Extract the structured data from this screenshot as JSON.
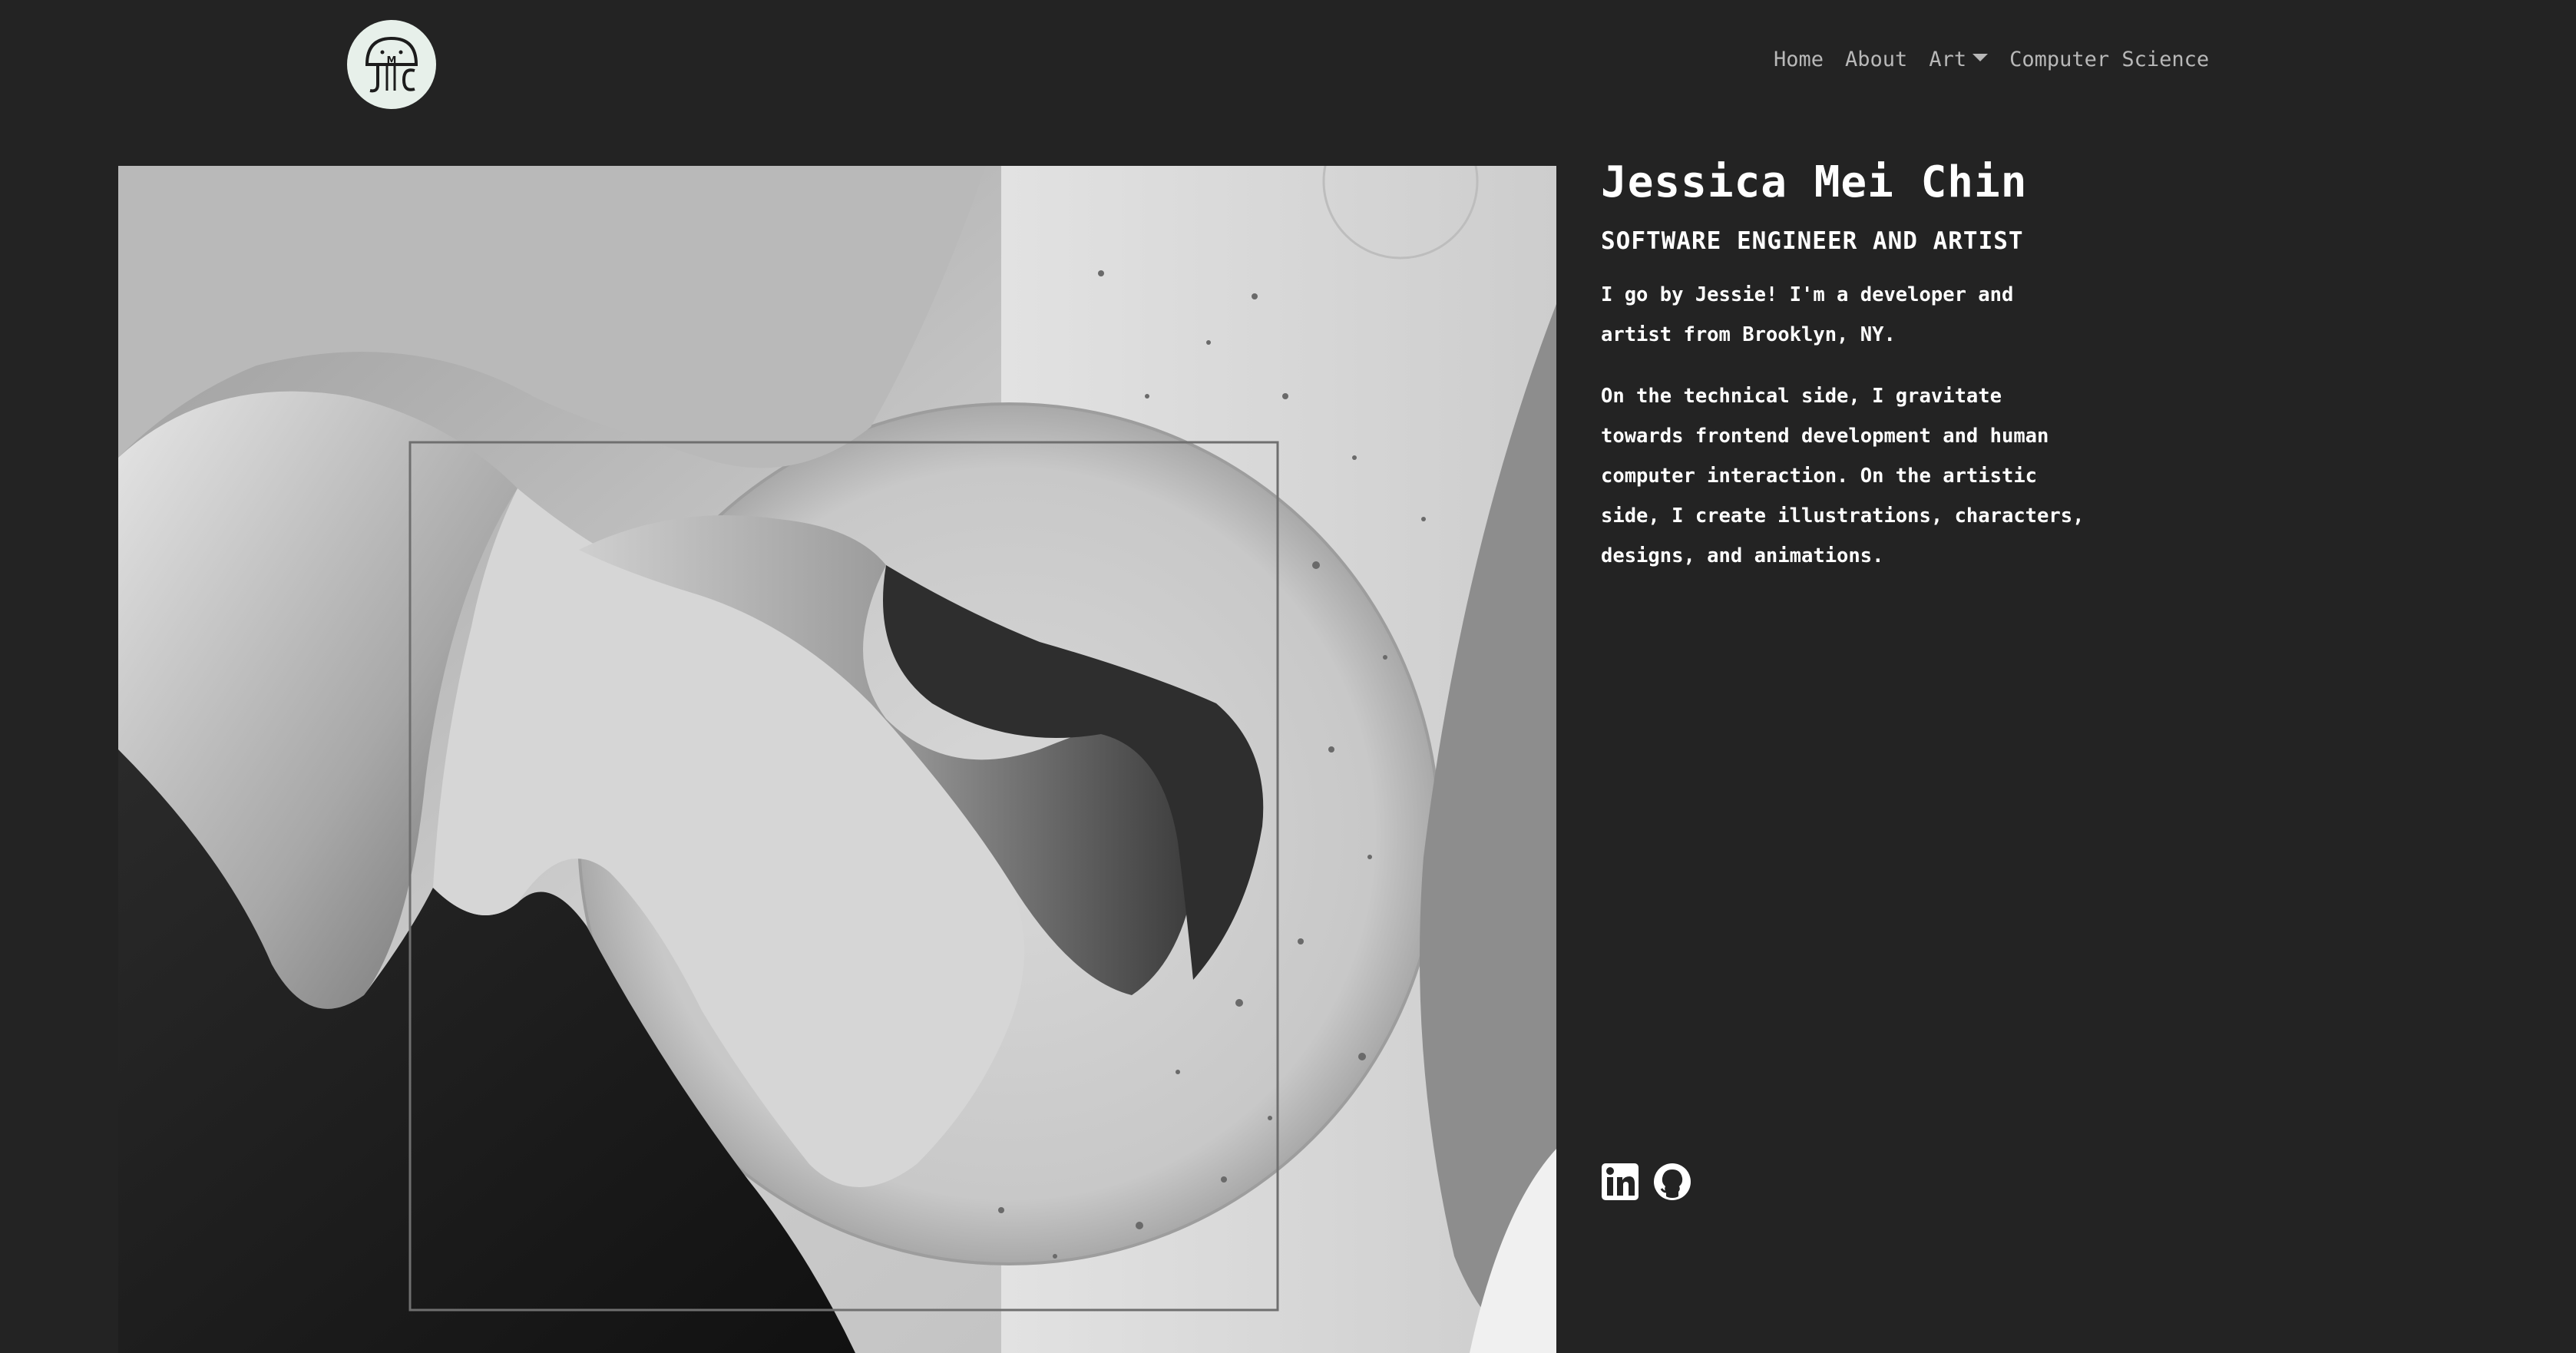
{
  "nav": {
    "logo_alt": "JMC",
    "links": [
      {
        "label": "Home"
      },
      {
        "label": "About"
      },
      {
        "label": "Art"
      },
      {
        "label": "Computer Science"
      }
    ]
  },
  "hero": {
    "name": "Jessica Mei Chin",
    "subtitle": "SOFTWARE ENGINEER AND ARTIST",
    "bio": [
      "I go by Jessie! I'm a developer and artist from Brooklyn, NY.",
      "On the technical side, I gravitate towards frontend development and human computer interaction. On the artistic side, I create illustrations, characters, designs, and animations."
    ]
  },
  "socials": [
    {
      "icon": "linkedin-icon"
    },
    {
      "icon": "github-icon"
    }
  ],
  "colors": {
    "background": "#232323",
    "nav_text": "#b8b8b8",
    "text": "#ffffff",
    "logo_bg": "#e7f0ea"
  }
}
